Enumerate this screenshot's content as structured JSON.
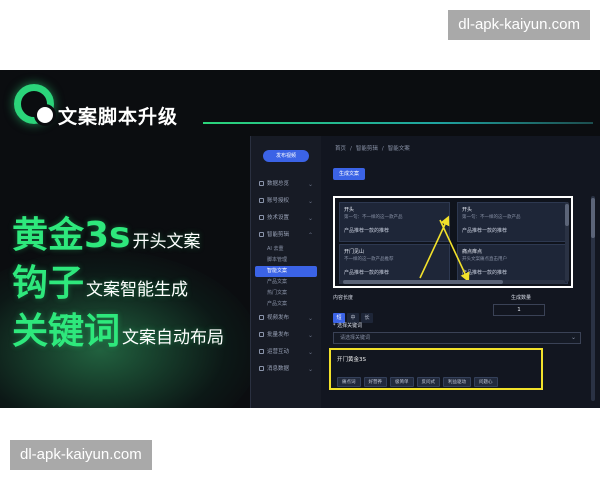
{
  "watermark": {
    "top": "dl-apk-kaiyun.com",
    "bottom": "dl-apk-kaiyun.com"
  },
  "banner": {
    "title": "文案脚本升级",
    "headlines": [
      {
        "big": "黄金3s",
        "small": "开头文案"
      },
      {
        "big": "钩子",
        "small": "文案智能生成"
      },
      {
        "big": "关键词",
        "small": "文案自动布局"
      }
    ],
    "accent_color": "#2ee87c"
  },
  "app": {
    "brand_button": "发布视频",
    "sidebar": [
      {
        "label": "数据总览",
        "icon": "chart-icon"
      },
      {
        "label": "账号授权",
        "icon": "key-icon"
      },
      {
        "label": "技术设置",
        "icon": "settings-icon"
      },
      {
        "label": "智能剪辑",
        "icon": "scissors-icon",
        "subs": [
          {
            "label": "AI 去重",
            "active": false
          },
          {
            "label": "脚本管理",
            "active": false
          },
          {
            "label": "智能文案",
            "active": true
          },
          {
            "label": "产品文案",
            "active": false
          },
          {
            "label": "热门文案",
            "active": false
          },
          {
            "label": "产品文案",
            "active": false
          }
        ]
      },
      {
        "label": "视频发布",
        "icon": "video-icon"
      },
      {
        "label": "批量发布",
        "icon": "upload-icon"
      },
      {
        "label": "运营互动",
        "icon": "chat-icon"
      },
      {
        "label": "消息数据",
        "icon": "message-icon"
      }
    ],
    "breadcrumb": [
      "首页",
      "/",
      "智能剪辑",
      "/",
      "智能文案"
    ],
    "generate_button": "生成文案",
    "cards": [
      {
        "tag": "开头",
        "text": "第一句：不一样的这一款产品",
        "body": "产品推荐一款的推荐"
      },
      {
        "tag": "开头",
        "text": "第一句：不一样的这一款产品",
        "body": "产品推荐一款的推荐"
      },
      {
        "tag": "开门见山",
        "text": "不一样的这一款产品推荐",
        "body": "产品推荐一款的推荐"
      },
      {
        "tag": "痛点痒点",
        "text": "开头文案痛点直击用户",
        "body": "产品推荐一款的推荐"
      }
    ],
    "length_label": "内容长度",
    "length_options": [
      "短",
      "中",
      "长"
    ],
    "length_selected": 0,
    "count_label": "生成数量",
    "count_value": "1",
    "keyword_label": "* 选择关键词",
    "keyword_placeholder": "请选择关键词",
    "keyword_panel_title": "开门黄金3S",
    "keyword_tags": [
      "痛点词",
      "好营养",
      "极简单",
      "反问式",
      "利益驱动",
      "问题心"
    ]
  }
}
